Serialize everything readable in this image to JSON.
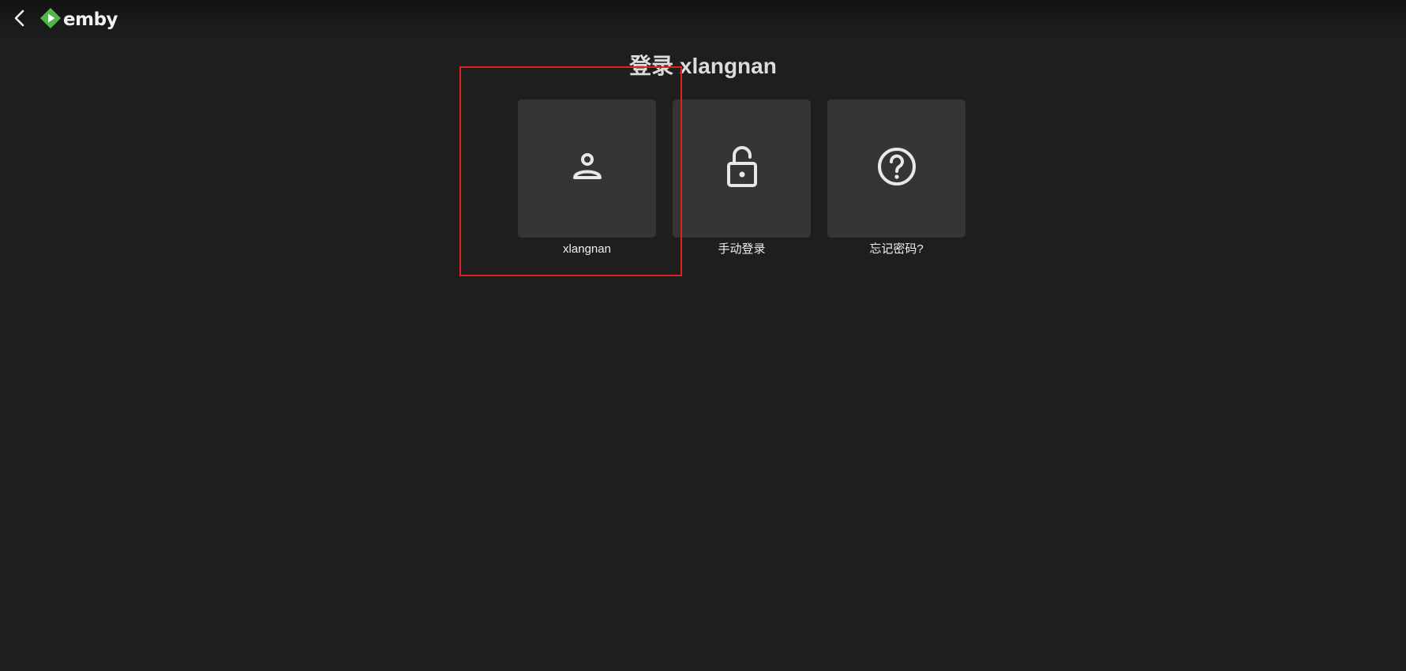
{
  "header": {
    "back_icon": "chevron-left-icon",
    "logo_icon": "emby-logo-icon",
    "logo_text": "emby",
    "brand_color": "#52b54b"
  },
  "page": {
    "title": "登录 xlangnan"
  },
  "cards": [
    {
      "icon": "person-icon",
      "label": "xlangnan"
    },
    {
      "icon": "unlock-icon",
      "label": "手动登录"
    },
    {
      "icon": "help-circle-icon",
      "label": "忘记密码?"
    }
  ],
  "highlight": {
    "color": "#e0201f"
  }
}
